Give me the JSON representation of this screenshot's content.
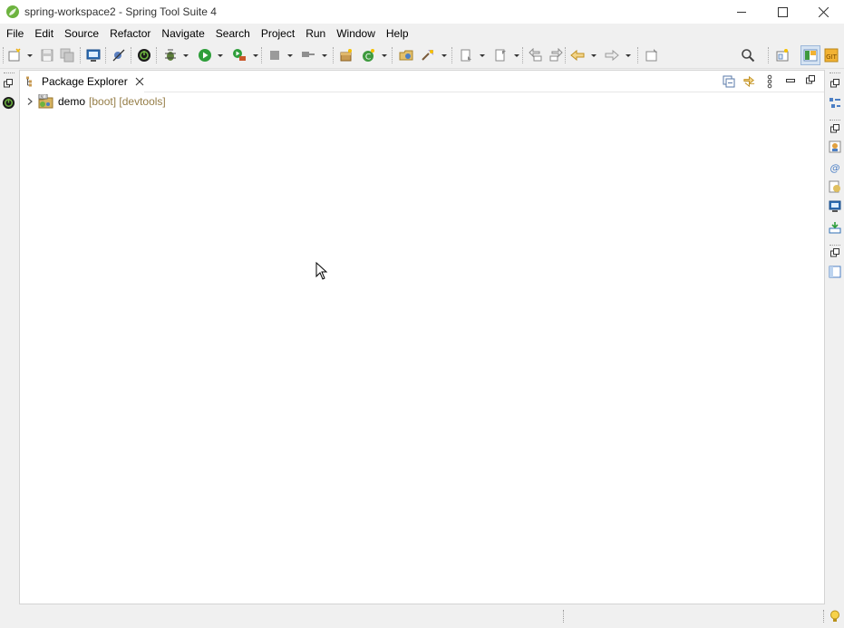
{
  "window": {
    "title": "spring-workspace2 - Spring Tool Suite 4",
    "app_icon": "spring-leaf-icon",
    "controls": [
      "minimize-icon",
      "maximize-icon",
      "close-icon"
    ]
  },
  "menubar": {
    "items": [
      "File",
      "Edit",
      "Source",
      "Refactor",
      "Navigate",
      "Search",
      "Project",
      "Run",
      "Window",
      "Help"
    ]
  },
  "toolbar": {
    "icons": [
      "new-wizard-icon",
      "save-icon",
      "save-all-icon",
      "terminal-icon",
      "skip-breakpoints-icon",
      "spring-boot-dashboard-icon",
      "debug-icon",
      "run-icon",
      "run-external-tools-icon",
      "stop-icon",
      "disconnect-icon",
      "new-java-package-icon",
      "new-java-class-icon",
      "open-type-icon",
      "open-task-icon",
      "next-annotation-icon",
      "previous-annotation-icon",
      "last-edit-location-icon",
      "back-icon",
      "forward-icon",
      "pin-editor-icon",
      "search-icon",
      "open-perspective-icon",
      "java-perspective-icon",
      "git-perspective-icon"
    ]
  },
  "package_explorer": {
    "tab_label": "Package Explorer",
    "view_actions": [
      "collapse-all-icon",
      "link-with-editor-icon",
      "view-menu-icon",
      "minimize-view-icon",
      "maximize-view-icon"
    ],
    "tree": [
      {
        "name": "demo",
        "decoration": "[boot] [devtools]",
        "expanded": false
      }
    ]
  },
  "colors": {
    "decoration": "#957d47",
    "spring_green": "#6db33f",
    "view_background": "#ffffff",
    "chrome_background": "#f0f0f0"
  }
}
